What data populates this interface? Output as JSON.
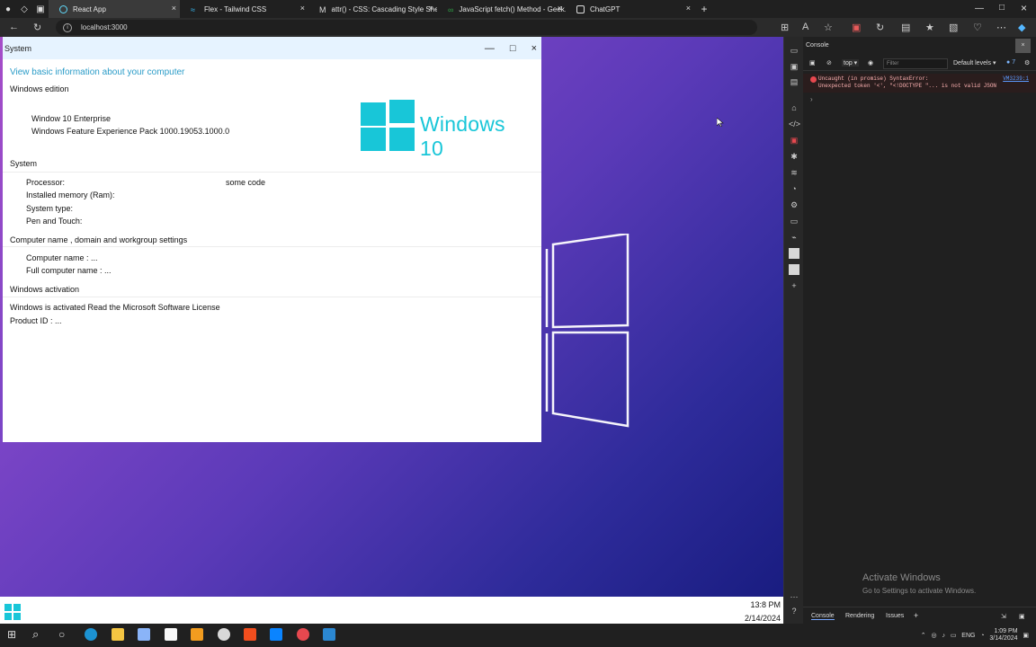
{
  "browser": {
    "tabs": [
      {
        "label": "React App",
        "active": true
      },
      {
        "label": "Flex - Tailwind CSS",
        "active": false
      },
      {
        "label": "attr() - CSS: Cascading Style She...",
        "active": false
      },
      {
        "label": "JavaScript fetch() Method - Geek...",
        "active": false
      },
      {
        "label": "ChatGPT",
        "active": false
      }
    ],
    "new_tab": "+",
    "url": "localhost:3000"
  },
  "system_window": {
    "title": "System",
    "heading": "View basic information about your computer",
    "sections": {
      "windows_edition": "Windows edition",
      "system": "System",
      "computer_name": "Computer name , domain and workgroup settings",
      "activation": "Windows activation"
    },
    "edition": {
      "name": "Window 10 Enterprise",
      "pack": "Windows Feature Experience Pack 1000.19053.1000.0"
    },
    "system": {
      "processor_label": "Processor:",
      "processor_value": "some code",
      "memory_label": "Installed memory (Ram):",
      "type_label": "System type:",
      "pen_label": "Pen and Touch:"
    },
    "computer": {
      "name_label": "Computer name : ...",
      "full_name_label": "Full computer name : ..."
    },
    "activation": {
      "status": "Windows is activated Read the Microsoft Software License",
      "product_id": "Product ID : ..."
    },
    "logo_text": "Windows 10"
  },
  "inner_taskbar": {
    "time": "13:8 PM",
    "date": "2/14/2024"
  },
  "devtools": {
    "title": "Console",
    "context": "top",
    "filter_placeholder": "Filter",
    "levels": "Default levels",
    "issue_count": "7",
    "error": {
      "message": "Uncaught (in promise) SyntaxError:\nUnexpected token '<', \"<!DOCTYPE \"... is not valid JSON",
      "link": "VM3239:1"
    },
    "activate_title": "Activate Windows",
    "activate_subtitle": "Go to Settings to activate Windows.",
    "bottom_tabs": [
      "Console",
      "Rendering",
      "Issues"
    ],
    "bottom_add": "+"
  },
  "os_taskbar": {
    "language": "ENG",
    "time": "1:09 PM",
    "date": "3/14/2024"
  },
  "colors": {
    "accent": "#18c6d8",
    "link": "#2b9cc8",
    "error": "#e6484f"
  }
}
